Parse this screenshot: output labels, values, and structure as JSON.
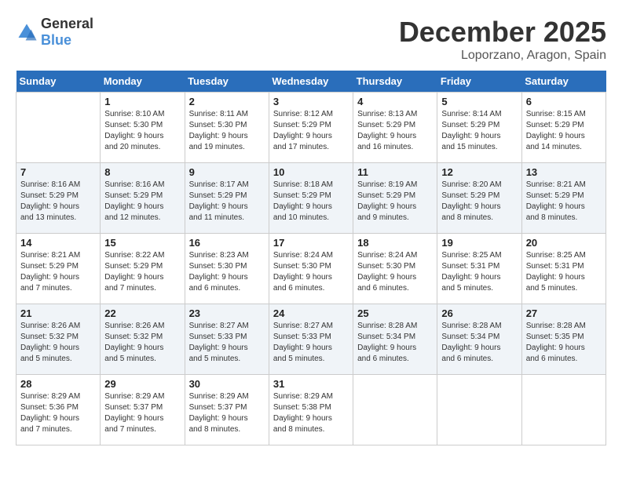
{
  "header": {
    "logo_general": "General",
    "logo_blue": "Blue",
    "month_title": "December 2025",
    "location": "Loporzano, Aragon, Spain"
  },
  "calendar": {
    "days_of_week": [
      "Sunday",
      "Monday",
      "Tuesday",
      "Wednesday",
      "Thursday",
      "Friday",
      "Saturday"
    ],
    "weeks": [
      [
        {
          "day": "",
          "info": ""
        },
        {
          "day": "1",
          "info": "Sunrise: 8:10 AM\nSunset: 5:30 PM\nDaylight: 9 hours\nand 20 minutes."
        },
        {
          "day": "2",
          "info": "Sunrise: 8:11 AM\nSunset: 5:30 PM\nDaylight: 9 hours\nand 19 minutes."
        },
        {
          "day": "3",
          "info": "Sunrise: 8:12 AM\nSunset: 5:29 PM\nDaylight: 9 hours\nand 17 minutes."
        },
        {
          "day": "4",
          "info": "Sunrise: 8:13 AM\nSunset: 5:29 PM\nDaylight: 9 hours\nand 16 minutes."
        },
        {
          "day": "5",
          "info": "Sunrise: 8:14 AM\nSunset: 5:29 PM\nDaylight: 9 hours\nand 15 minutes."
        },
        {
          "day": "6",
          "info": "Sunrise: 8:15 AM\nSunset: 5:29 PM\nDaylight: 9 hours\nand 14 minutes."
        }
      ],
      [
        {
          "day": "7",
          "info": "Sunrise: 8:16 AM\nSunset: 5:29 PM\nDaylight: 9 hours\nand 13 minutes."
        },
        {
          "day": "8",
          "info": "Sunrise: 8:16 AM\nSunset: 5:29 PM\nDaylight: 9 hours\nand 12 minutes."
        },
        {
          "day": "9",
          "info": "Sunrise: 8:17 AM\nSunset: 5:29 PM\nDaylight: 9 hours\nand 11 minutes."
        },
        {
          "day": "10",
          "info": "Sunrise: 8:18 AM\nSunset: 5:29 PM\nDaylight: 9 hours\nand 10 minutes."
        },
        {
          "day": "11",
          "info": "Sunrise: 8:19 AM\nSunset: 5:29 PM\nDaylight: 9 hours\nand 9 minutes."
        },
        {
          "day": "12",
          "info": "Sunrise: 8:20 AM\nSunset: 5:29 PM\nDaylight: 9 hours\nand 8 minutes."
        },
        {
          "day": "13",
          "info": "Sunrise: 8:21 AM\nSunset: 5:29 PM\nDaylight: 9 hours\nand 8 minutes."
        }
      ],
      [
        {
          "day": "14",
          "info": "Sunrise: 8:21 AM\nSunset: 5:29 PM\nDaylight: 9 hours\nand 7 minutes."
        },
        {
          "day": "15",
          "info": "Sunrise: 8:22 AM\nSunset: 5:29 PM\nDaylight: 9 hours\nand 7 minutes."
        },
        {
          "day": "16",
          "info": "Sunrise: 8:23 AM\nSunset: 5:30 PM\nDaylight: 9 hours\nand 6 minutes."
        },
        {
          "day": "17",
          "info": "Sunrise: 8:24 AM\nSunset: 5:30 PM\nDaylight: 9 hours\nand 6 minutes."
        },
        {
          "day": "18",
          "info": "Sunrise: 8:24 AM\nSunset: 5:30 PM\nDaylight: 9 hours\nand 6 minutes."
        },
        {
          "day": "19",
          "info": "Sunrise: 8:25 AM\nSunset: 5:31 PM\nDaylight: 9 hours\nand 5 minutes."
        },
        {
          "day": "20",
          "info": "Sunrise: 8:25 AM\nSunset: 5:31 PM\nDaylight: 9 hours\nand 5 minutes."
        }
      ],
      [
        {
          "day": "21",
          "info": "Sunrise: 8:26 AM\nSunset: 5:32 PM\nDaylight: 9 hours\nand 5 minutes."
        },
        {
          "day": "22",
          "info": "Sunrise: 8:26 AM\nSunset: 5:32 PM\nDaylight: 9 hours\nand 5 minutes."
        },
        {
          "day": "23",
          "info": "Sunrise: 8:27 AM\nSunset: 5:33 PM\nDaylight: 9 hours\nand 5 minutes."
        },
        {
          "day": "24",
          "info": "Sunrise: 8:27 AM\nSunset: 5:33 PM\nDaylight: 9 hours\nand 5 minutes."
        },
        {
          "day": "25",
          "info": "Sunrise: 8:28 AM\nSunset: 5:34 PM\nDaylight: 9 hours\nand 6 minutes."
        },
        {
          "day": "26",
          "info": "Sunrise: 8:28 AM\nSunset: 5:34 PM\nDaylight: 9 hours\nand 6 minutes."
        },
        {
          "day": "27",
          "info": "Sunrise: 8:28 AM\nSunset: 5:35 PM\nDaylight: 9 hours\nand 6 minutes."
        }
      ],
      [
        {
          "day": "28",
          "info": "Sunrise: 8:29 AM\nSunset: 5:36 PM\nDaylight: 9 hours\nand 7 minutes."
        },
        {
          "day": "29",
          "info": "Sunrise: 8:29 AM\nSunset: 5:37 PM\nDaylight: 9 hours\nand 7 minutes."
        },
        {
          "day": "30",
          "info": "Sunrise: 8:29 AM\nSunset: 5:37 PM\nDaylight: 9 hours\nand 8 minutes."
        },
        {
          "day": "31",
          "info": "Sunrise: 8:29 AM\nSunset: 5:38 PM\nDaylight: 9 hours\nand 8 minutes."
        },
        {
          "day": "",
          "info": ""
        },
        {
          "day": "",
          "info": ""
        },
        {
          "day": "",
          "info": ""
        }
      ]
    ]
  }
}
